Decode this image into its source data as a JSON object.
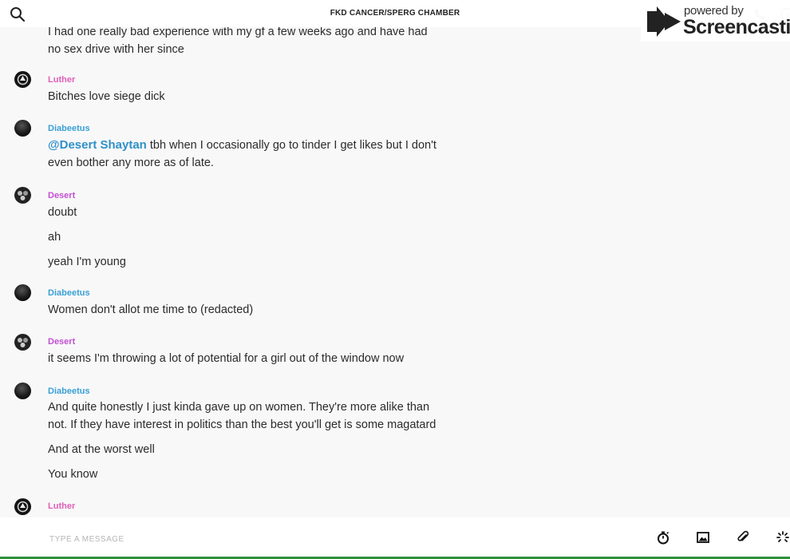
{
  "header": {
    "title": "FKD CANCER/SPERG CHAMBER"
  },
  "watermark": {
    "powered": "powered by",
    "brand": "Screencastify"
  },
  "colors": {
    "luther": "#e060b8",
    "diabeetus": "#3aa0d4",
    "desert": "#c250d0",
    "mention": "#2f90c8",
    "accent_bottom": "#2f8f3a"
  },
  "messages": [
    {
      "lines": [
        "I had one really bad experience with my gf a few weeks ago and have had no sex drive with her since"
      ]
    },
    {
      "author": "Luther",
      "texts": [
        "Bitches love siege dick"
      ]
    },
    {
      "author": "Diabeetus",
      "mention": "@Desert Shaytan",
      "texts": [
        " tbh when I occasionally go to tinder I get likes but I don't even bother any more as of late."
      ]
    },
    {
      "author": "Desert",
      "texts": [
        "doubt",
        "ah",
        "yeah I'm young"
      ]
    },
    {
      "author": "Diabeetus",
      "texts": [
        "Women don't allot me time to (redacted)"
      ]
    },
    {
      "author": "Desert",
      "texts": [
        "it seems I'm throwing a lot of potential for a girl out of the window now"
      ]
    },
    {
      "author": "Diabeetus",
      "texts": [
        "And quite honestly I just kinda gave up on women. They're more alike than not. If they have interest in politics than the best you'll get is some magatard",
        "And at the worst well",
        "You know"
      ]
    },
    {
      "author": "Luther",
      "texts": []
    }
  ],
  "composer": {
    "placeholder": "TYPE A MESSAGE",
    "value": "",
    "icons": [
      "stopwatch-icon",
      "image-icon",
      "paperclip-icon",
      "loading-icon"
    ]
  }
}
